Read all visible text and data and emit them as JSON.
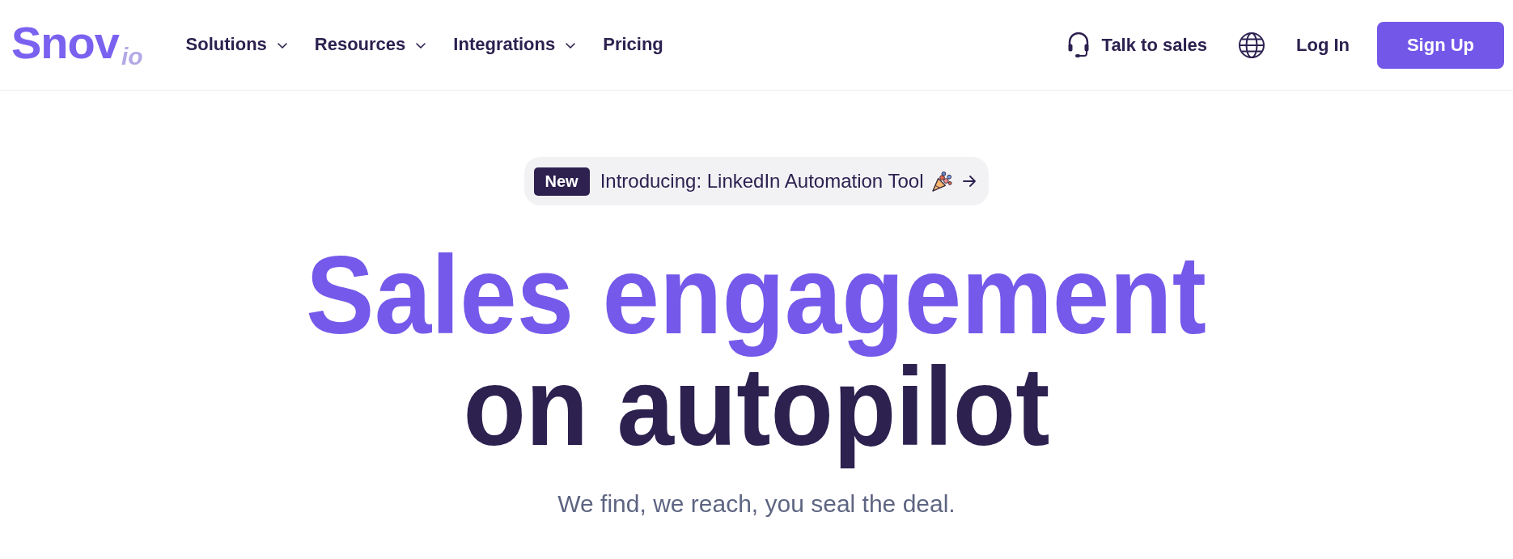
{
  "header": {
    "logo": {
      "name": "Snov",
      "suffix": "io"
    },
    "nav": [
      {
        "label": "Solutions",
        "kind": "dropdown"
      },
      {
        "label": "Resources",
        "kind": "dropdown"
      },
      {
        "label": "Integrations",
        "kind": "dropdown"
      },
      {
        "label": "Pricing",
        "kind": "link"
      }
    ],
    "talk_to_sales": "Talk to sales",
    "login": "Log In",
    "signup": "Sign Up"
  },
  "announcement": {
    "tag": "New",
    "text": "Introducing: LinkedIn Automation Tool"
  },
  "hero": {
    "title_line_1": "Sales engagement",
    "title_line_2": "on autopilot",
    "subtitle": "We find, we reach, you seal the deal."
  }
}
